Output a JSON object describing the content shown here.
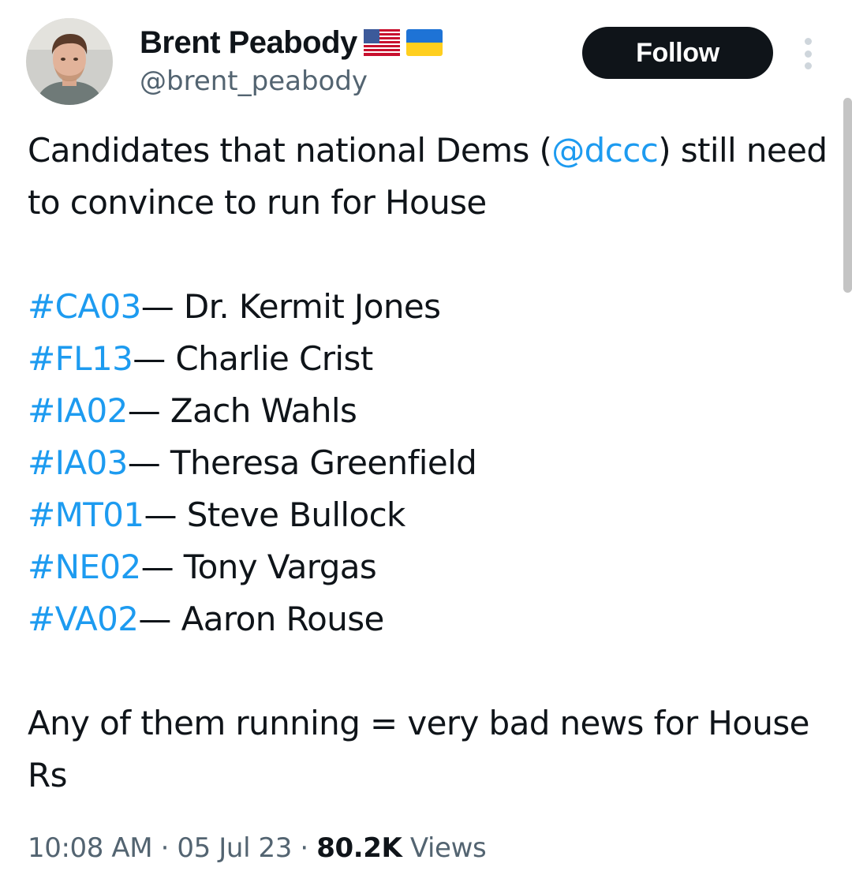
{
  "author": {
    "display_name": "Brent Peabody",
    "handle": "@brent_peabody",
    "flags": [
      "us-flag-icon",
      "ukraine-flag-icon"
    ]
  },
  "actions": {
    "follow_label": "Follow",
    "more_icon": "more-vertical-icon"
  },
  "tweet": {
    "intro_before": "Candidates that national Dems (",
    "mention": "@dccc",
    "intro_after": ") still need to convince to run for House",
    "candidates": [
      {
        "tag": "#CA03",
        "sep": "— ",
        "name": "Dr. Kermit Jones"
      },
      {
        "tag": "#FL13",
        "sep": "— ",
        "name": "Charlie Crist"
      },
      {
        "tag": "#IA02",
        "sep": "— ",
        "name": "Zach Wahls"
      },
      {
        "tag": "#IA03",
        "sep": "— ",
        "name": "Theresa Greenfield"
      },
      {
        "tag": "#MT01",
        "sep": "— ",
        "name": "Steve Bullock"
      },
      {
        "tag": "#NE02",
        "sep": "— ",
        "name": "Tony Vargas"
      },
      {
        "tag": "#VA02",
        "sep": "— ",
        "name": "Aaron Rouse"
      }
    ],
    "closing": "Any of them running = very bad news for House Rs"
  },
  "meta": {
    "time": "10:08 AM",
    "dot1": " · ",
    "date": "05 Jul 23",
    "dot2": " · ",
    "views_count": "80.2K",
    "views_label": " Views"
  },
  "colors": {
    "link": "#1d9bf0",
    "text": "#0f1419",
    "muted": "#536471",
    "follow_bg": "#0f1419"
  }
}
